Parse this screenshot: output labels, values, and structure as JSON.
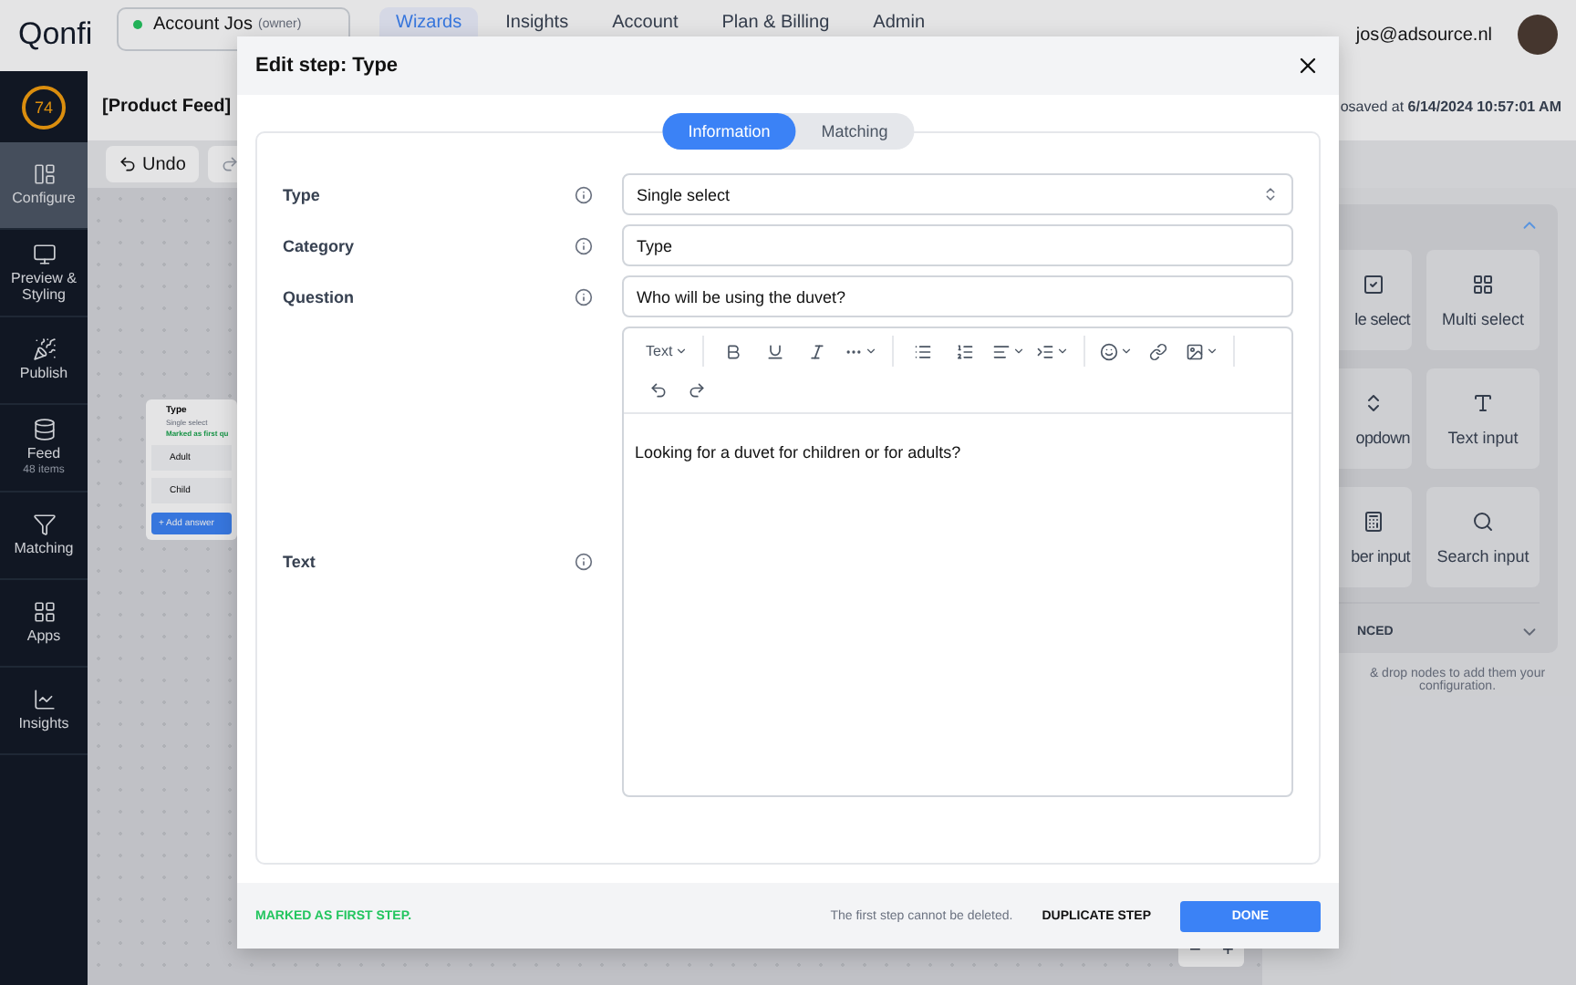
{
  "topbar": {
    "logo": "Qonfi",
    "account": {
      "name": "Account Jos",
      "role": "(owner)",
      "online": true
    },
    "nav": [
      {
        "label": "Wizards",
        "selected": true
      },
      {
        "label": "Insights",
        "selected": false
      },
      {
        "label": "Account",
        "selected": false
      },
      {
        "label": "Plan & Billing",
        "selected": false
      },
      {
        "label": "Admin",
        "selected": false
      }
    ],
    "user_email": "jos@adsource.nl"
  },
  "sidebar": {
    "score": "74",
    "items": [
      {
        "label": "Configure",
        "selected": true
      },
      {
        "label": "Preview & Styling",
        "selected": false
      },
      {
        "label": "Publish",
        "selected": false
      },
      {
        "label": "Feed",
        "sub": "48 items",
        "selected": false
      },
      {
        "label": "Matching",
        "selected": false
      },
      {
        "label": "Apps",
        "selected": false
      },
      {
        "label": "Insights",
        "selected": false
      }
    ]
  },
  "editor": {
    "title": "[Product Feed]",
    "saved_prefix": "osaved at",
    "saved_time": "6/14/2024 10:57:01 AM",
    "undo": "Undo"
  },
  "node": {
    "title": "Type",
    "subtitle": "Single select",
    "badge": "Marked as first qu",
    "answers": [
      "Adult",
      "Child"
    ],
    "add_answer": "+ Add answer"
  },
  "palette": {
    "tiles": [
      "le select",
      "Multi select",
      "opdown",
      "Text input",
      "ber input",
      "Search input"
    ],
    "advanced": "NCED",
    "hint": "& drop nodes to add them your configuration."
  },
  "zoom": {
    "out": "−",
    "in": "+"
  },
  "modal": {
    "title": "Edit step: Type",
    "tabs": [
      {
        "label": "Information",
        "selected": true
      },
      {
        "label": "Matching",
        "selected": false
      }
    ],
    "fields": [
      {
        "kind": "select",
        "label": "Type",
        "value": "Single select"
      },
      {
        "kind": "text",
        "label": "Category",
        "value": "Type"
      },
      {
        "kind": "text",
        "label": "Question",
        "value": "Who will be using the duvet?"
      },
      {
        "kind": "rich",
        "label": "Text",
        "value": "Looking for a duvet for children or for adults?"
      }
    ],
    "toolbar": [
      [
        {
          "kind": "style",
          "label": "Text",
          "menu": true
        }
      ],
      [
        {
          "kind": "bold",
          "menu": false
        },
        {
          "kind": "underline",
          "menu": false
        },
        {
          "kind": "italic",
          "menu": false
        },
        {
          "kind": "more",
          "menu": true
        }
      ],
      [
        {
          "kind": "bullets",
          "menu": false
        },
        {
          "kind": "numbers",
          "menu": false
        },
        {
          "kind": "align",
          "menu": true
        },
        {
          "kind": "indent",
          "menu": true
        }
      ],
      [
        {
          "kind": "emoji",
          "menu": true
        },
        {
          "kind": "link",
          "menu": false
        },
        {
          "kind": "image",
          "menu": true
        }
      ]
    ],
    "toolbar_row2": [
      {
        "kind": "undo",
        "menu": false
      },
      {
        "kind": "redo",
        "menu": false
      }
    ],
    "footer": {
      "status": "MARKED AS FIRST STEP.",
      "note": "The first step cannot be deleted.",
      "secondary": "DUPLICATE STEP",
      "primary": "DONE"
    }
  }
}
